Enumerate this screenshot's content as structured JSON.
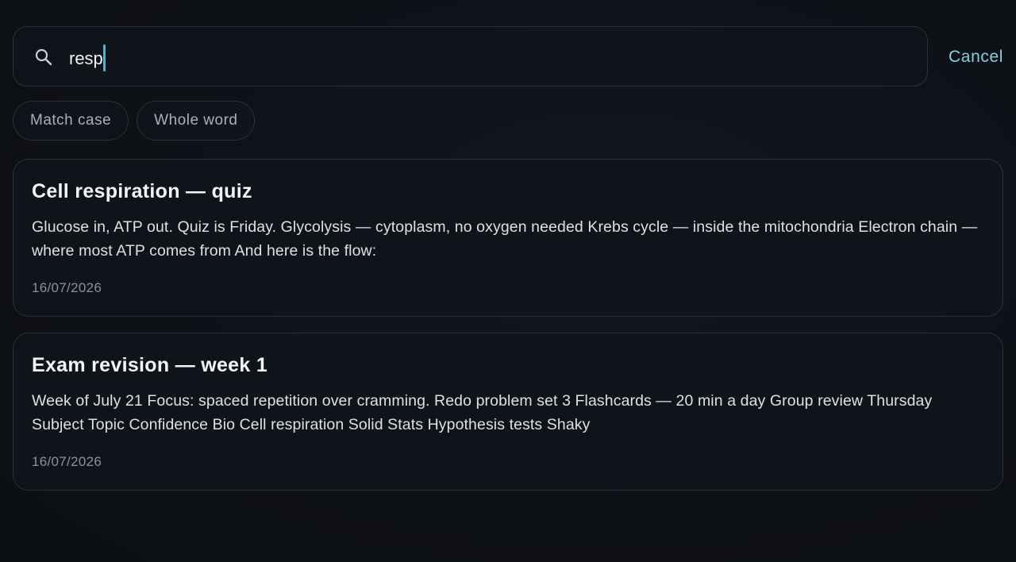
{
  "search": {
    "query": "resp",
    "icon": "search-icon",
    "cancel_label": "Cancel",
    "accent_color": "#7ed3de"
  },
  "filters": [
    {
      "label": "Match case",
      "active": false
    },
    {
      "label": "Whole word",
      "active": false
    }
  ],
  "results": [
    {
      "title": "Cell respiration — quiz",
      "snippet": "Glucose in, ATP out. Quiz is Friday. Glycolysis — cytoplasm, no oxygen needed Krebs cycle — inside the mitochondria Electron chain — where most ATP comes from And here is the flow:",
      "date": "16/07/2026"
    },
    {
      "title": "Exam revision — week 1",
      "snippet": "Week of July 21 Focus: spaced repetition over cramming. Redo problem set 3 Flashcards — 20 min a day Group review Thursday Subject Topic Confidence Bio Cell respiration Solid Stats Hypothesis tests Shaky",
      "date": "16/07/2026"
    }
  ]
}
